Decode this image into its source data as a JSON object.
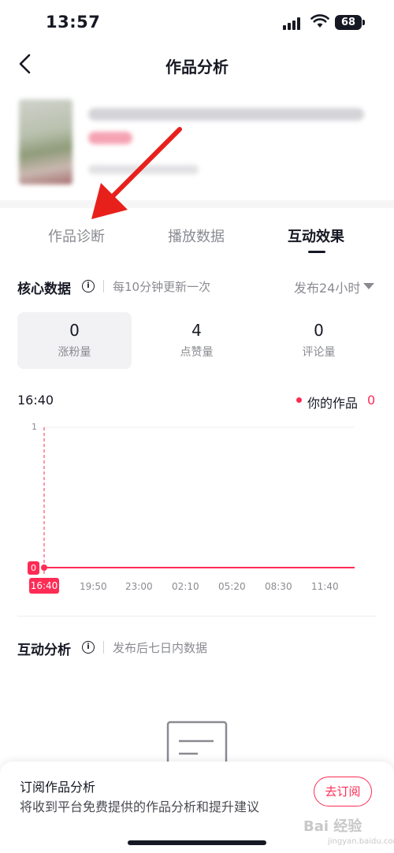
{
  "status": {
    "time": "13:57",
    "battery": "68"
  },
  "nav": {
    "title": "作品分析"
  },
  "tabs": [
    "作品诊断",
    "播放数据",
    "互动效果"
  ],
  "core": {
    "title": "核心数据",
    "note": "每10分钟更新一次",
    "dropdown": "发布24小时",
    "metrics": [
      {
        "value": "0",
        "label": "涨粉量"
      },
      {
        "value": "4",
        "label": "点赞量"
      },
      {
        "value": "0",
        "label": "评论量"
      }
    ]
  },
  "chart_data": {
    "type": "line",
    "x": [
      "16:40",
      "19:50",
      "23:00",
      "02:10",
      "05:20",
      "08:30",
      "11:40"
    ],
    "series": [
      {
        "name": "你的作品",
        "values": [
          0,
          0,
          0,
          0,
          0,
          0,
          0
        ]
      }
    ],
    "ylim": [
      0,
      1
    ],
    "yticks": [
      "1",
      "0"
    ],
    "selected": {
      "x": "16:40",
      "value": "0"
    },
    "colors": {
      "series": "#fe2c55"
    }
  },
  "chart": {
    "time_label": "16:40",
    "legend_label": "你的作品",
    "legend_value": "0"
  },
  "interaction": {
    "title": "互动分析",
    "note": "发布后七日内数据"
  },
  "sheet": {
    "title": "订阅作品分析",
    "desc": "将收到平台免费提供的作品分析和提升建议",
    "button": "去订阅"
  },
  "watermark": {
    "main": "Bai 经验",
    "sub": "jingyan.baidu.com"
  },
  "colors": {
    "accent": "#fe2c55",
    "text": "#161823",
    "muted": "#8a8b91"
  }
}
